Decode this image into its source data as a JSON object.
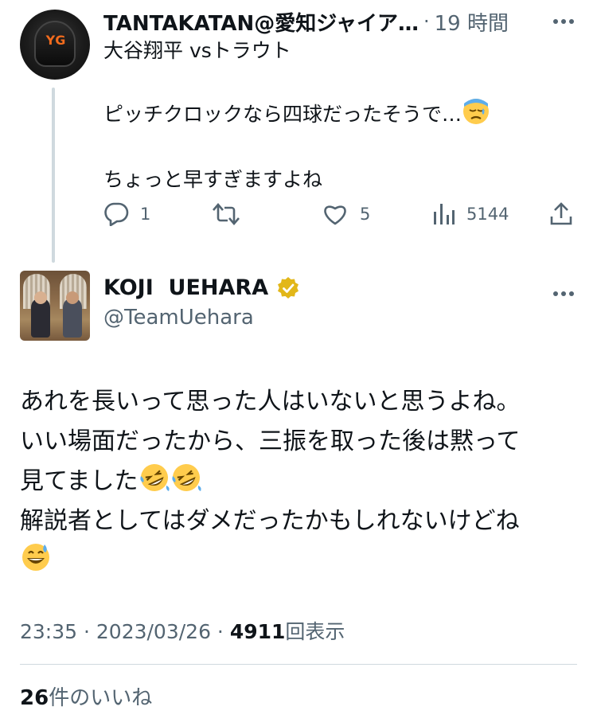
{
  "reply_tweet": {
    "display_name": "TANTAKATAN@愛知ジャイア…",
    "separator": "·",
    "time": "19 時間",
    "lines": [
      "大谷翔平 vsトラウト",
      "ピッチクロックなら四球だったそうで…",
      "ちょっと早すぎますよね"
    ],
    "emoji_line2": "sweat-face-emoji",
    "actions": {
      "reply_count": "1",
      "retweet_count": "",
      "like_count": "5",
      "views_count": "5144"
    }
  },
  "main_tweet": {
    "display_name": "KOJI  UEHARA",
    "handle": "@TeamUehara",
    "verified_color": "#e2b719",
    "lines": [
      "あれを長いって思った人はいないと思うよね。",
      "いい場面だったから、三振を取った後は黙って",
      "見てました",
      "解説者としてはダメだったかもしれないけどね"
    ],
    "emoji_line3": [
      "rofl-emoji",
      "rofl-emoji"
    ],
    "emoji_line5": "grinning-sweat-emoji",
    "timestamp": "23:35 · 2023/03/26 · ",
    "views_number": "4911",
    "views_label": "回表示",
    "likes_number": "26",
    "likes_label": "件のいいね"
  },
  "colors": {
    "text_primary": "#0f1419",
    "text_secondary": "#536471",
    "divider": "#cfd9de"
  }
}
